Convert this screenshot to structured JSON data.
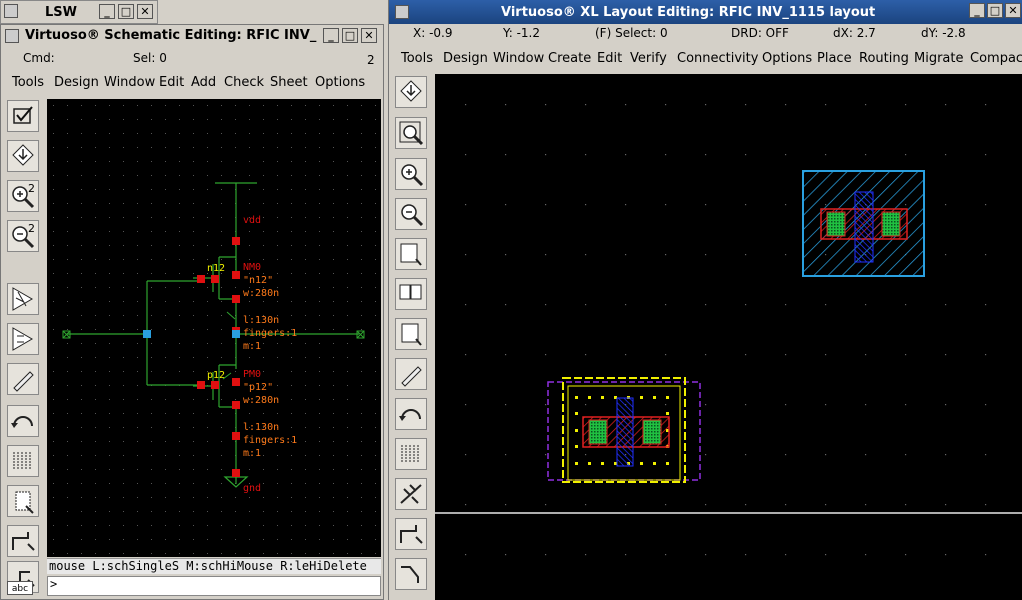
{
  "lsw": {
    "title": "LSW"
  },
  "schematic": {
    "title": "Virtuoso® Schematic Editing: RFIC INV_",
    "cmd_label": "Cmd:",
    "sel_label": "Sel: 0",
    "num": "2",
    "menu": [
      "Tools",
      "Design",
      "Window",
      "Edit",
      "Add",
      "Check",
      "Sheet",
      "Options"
    ],
    "labels": {
      "vdd": "vdd",
      "gnd": "gnd",
      "n12": "n12",
      "p12": "p12",
      "nm_name": "NM0",
      "nm_model": "\"n12\"",
      "nm_w": "w:280n",
      "nm_l": "l:130n",
      "nm_f": "fingers:1",
      "nm_m": "m:1",
      "pm_name": "PM0",
      "pm_model": "\"p12\"",
      "pm_w": "w:280n",
      "pm_l": "l:130n",
      "pm_f": "fingers:1",
      "pm_m": "m:1"
    },
    "mouse_status": "mouse L:schSingleS M:schHiMouse R:leHiDelete",
    "prompt": ">",
    "bottom_label": "abc"
  },
  "layout": {
    "title": "Virtuoso® XL Layout Editing: RFIC INV_1115 layout",
    "x": "X: -0.9",
    "y": "Y: -1.2",
    "select": "(F) Select: 0",
    "drd": "DRD: OFF",
    "dx": "dX:  2.7",
    "dy": "dY: -2.8",
    "menu": [
      "Tools",
      "Design",
      "Window",
      "Create",
      "Edit",
      "Verify",
      "Connectivity",
      "Options",
      "Place",
      "Routing",
      "Migrate",
      "Compact"
    ]
  },
  "colors": {
    "title_bg": "#2d5fa8",
    "wire": "#2fa52f",
    "pin": "#e01010",
    "label": "#ff7a1a",
    "node": "#2aa0e0",
    "nwell": "#2aa0e0",
    "poly": "#2030ff",
    "diff": "#e02020",
    "contact": "#20c040",
    "yellow": "#f0f000",
    "purple": "#9030e0"
  }
}
